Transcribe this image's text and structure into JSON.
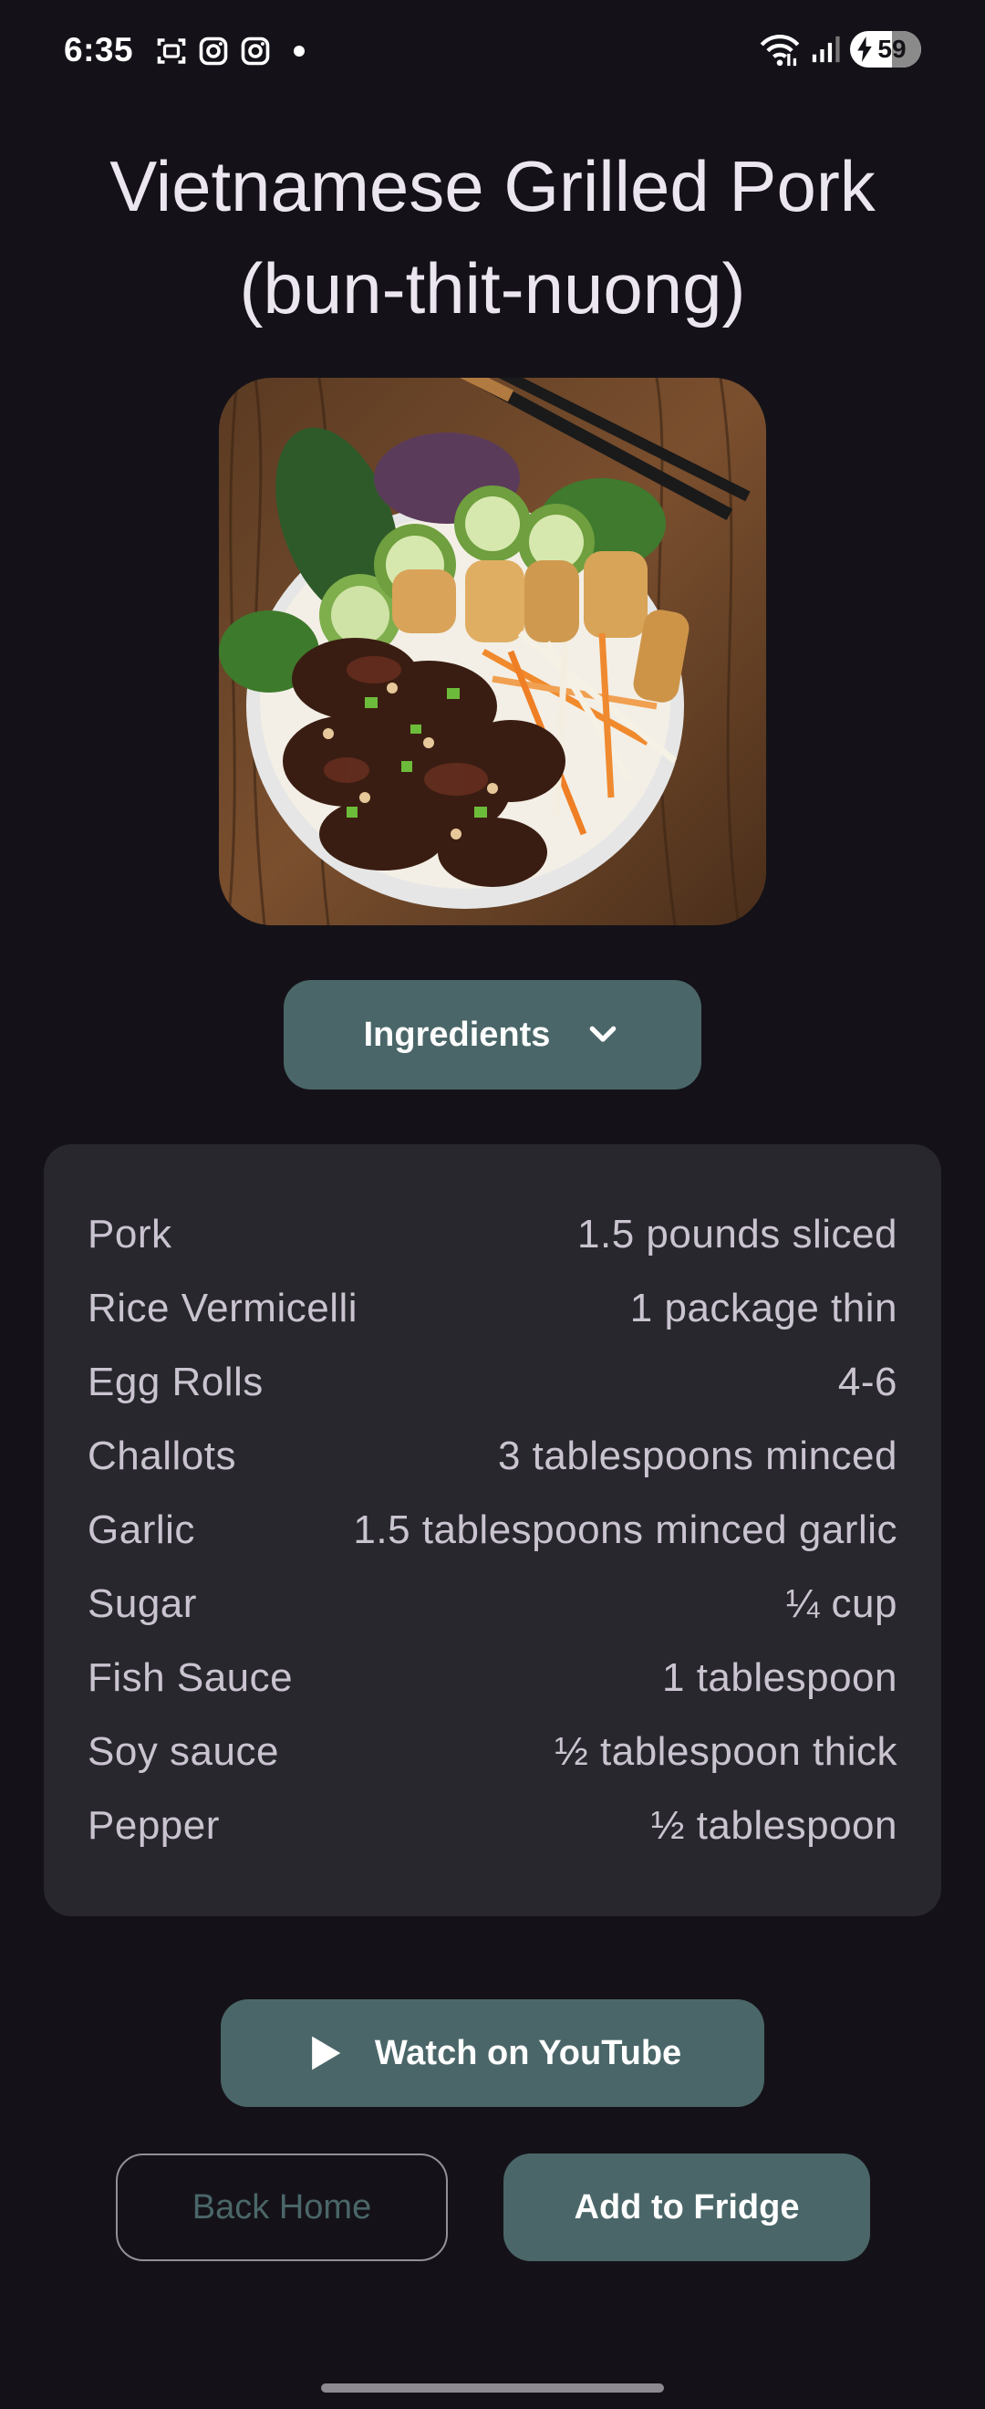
{
  "status_bar": {
    "time": "6:35",
    "battery_level": "59",
    "battery_fraction": 0.59,
    "icons_left": [
      "screenshot-icon",
      "instagram-icon",
      "instagram-icon",
      "notification-dot"
    ],
    "icons_right": [
      "wifi-icon",
      "signal-icon",
      "battery-icon"
    ]
  },
  "recipe": {
    "title_line1": "Vietnamese Grilled Pork",
    "title_line2": "(bun-thit-nuong)"
  },
  "ingredients_button": {
    "label": "Ingredients",
    "icon": "chevron-down-icon"
  },
  "ingredients": [
    {
      "name": "Pork",
      "qty": "1.5 pounds sliced"
    },
    {
      "name": "Rice Vermicelli",
      "qty": "1 package thin"
    },
    {
      "name": "Egg Rolls",
      "qty": "4-6"
    },
    {
      "name": "Challots",
      "qty": "3 tablespoons minced"
    },
    {
      "name": "Garlic",
      "qty": "1.5 tablespoons minced garlic"
    },
    {
      "name": "Sugar",
      "qty": "¼ cup"
    },
    {
      "name": "Fish Sauce",
      "qty": "1 tablespoon"
    },
    {
      "name": "Soy sauce",
      "qty": "½ tablespoon thick"
    },
    {
      "name": "Pepper",
      "qty": "½ tablespoon"
    }
  ],
  "actions": {
    "youtube_label": "Watch on YouTube",
    "youtube_icon": "play-icon",
    "back_label": "Back Home",
    "fridge_label": "Add to Fridge"
  },
  "colors": {
    "background": "#141218",
    "card": "#29272e",
    "accent": "#4a6668",
    "text": "#ece6f0",
    "muted_text": "#cac4d0"
  }
}
